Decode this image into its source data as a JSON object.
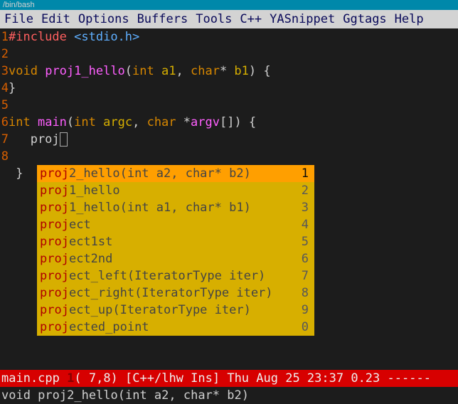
{
  "titlebar": "/bin/bash",
  "menu": [
    "File",
    "Edit",
    "Options",
    "Buffers",
    "Tools",
    "C++",
    "YASnippet",
    "Ggtags",
    "Help"
  ],
  "lines": {
    "l1_preproc": "#include",
    "l1_path": "<stdio.h>",
    "l3_kw": "void",
    "l3_func": "proj1_hello",
    "l3_sig_open": "(",
    "l3_t1": "int",
    "l3_p1": "a1",
    "l3_comma": ", ",
    "l3_t2": "char",
    "l3_star": "* ",
    "l3_p2": "b1",
    "l3_sig_close": ") {",
    "l4": "}",
    "l6_kw": "int",
    "l6_func": "main",
    "l6_open": "(",
    "l6_t1": "int",
    "l6_p1": "argc",
    "l6_c": ", ",
    "l6_t2": "char",
    "l6_star": " *",
    "l6_p2": "argv",
    "l6_arr": "[]) {",
    "l7_typed": "   proj",
    "l8_brace": " }"
  },
  "completions": [
    {
      "prefix": "proj",
      "rest": "2_hello(int a2, char* b2)",
      "n": "1",
      "sel": true
    },
    {
      "prefix": "proj",
      "rest": "1_hello",
      "n": "2"
    },
    {
      "prefix": "proj",
      "rest": "1_hello(int a1, char* b1)",
      "n": "3"
    },
    {
      "prefix": "proj",
      "rest": "ect",
      "n": "4"
    },
    {
      "prefix": "proj",
      "rest": "ect1st",
      "n": "5"
    },
    {
      "prefix": "proj",
      "rest": "ect2nd",
      "n": "6"
    },
    {
      "prefix": "proj",
      "rest": "ect_left(IteratorType iter)",
      "n": "7"
    },
    {
      "prefix": "proj",
      "rest": "ect_right(IteratorType iter)",
      "n": "8"
    },
    {
      "prefix": "proj",
      "rest": "ect_up(IteratorType iter)",
      "n": "9"
    },
    {
      "prefix": "proj",
      "rest": "ected_point",
      "n": "0"
    }
  ],
  "modeline": {
    "file": "main.cpp ",
    "flag": "1",
    "pos": "( 7,8) ",
    "mode": "[C++/lhw Ins] ",
    "time": "Thu Aug 25 23:37 ",
    "load": "0.23 ",
    "dashes": "------"
  },
  "echo": "void proj2_hello(int a2, char* b2)"
}
